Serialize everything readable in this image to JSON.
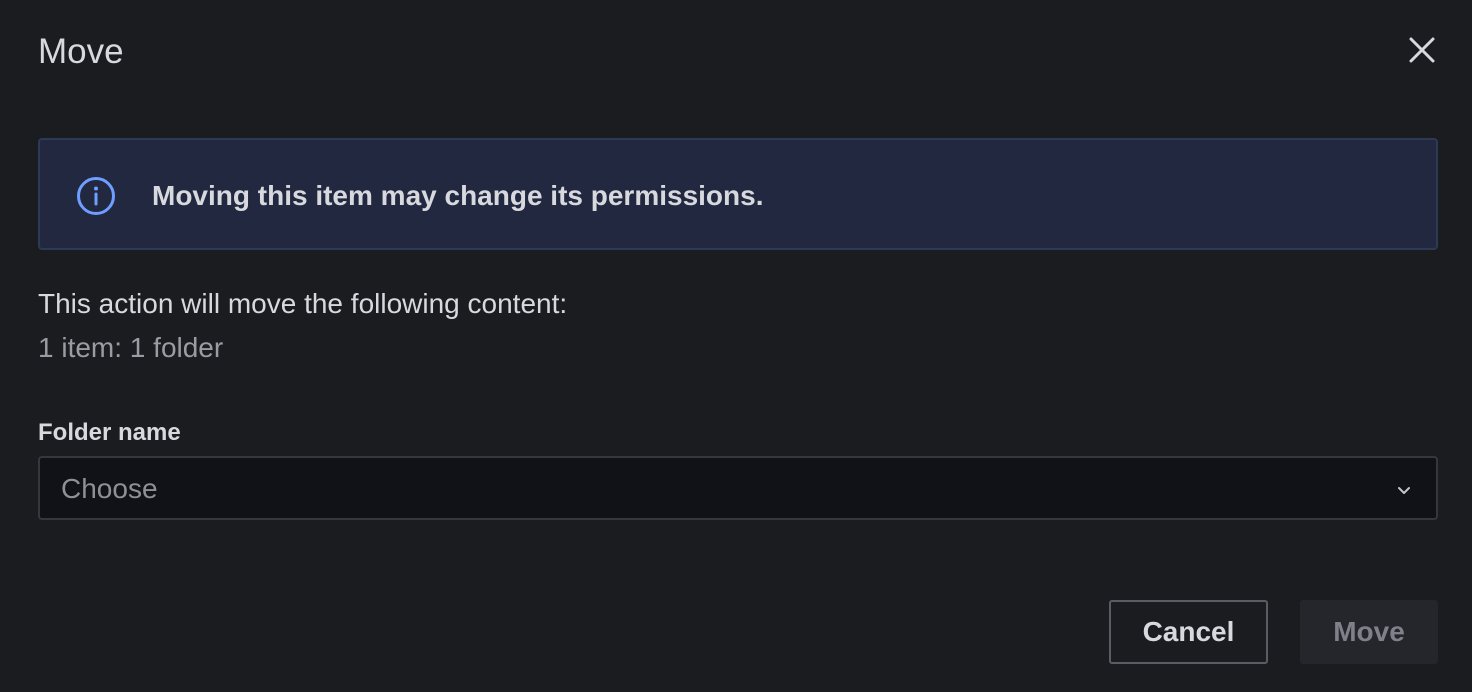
{
  "dialog": {
    "title": "Move",
    "close_icon": "close-icon"
  },
  "alert": {
    "icon": "info-circle-icon",
    "text": "Moving this item may change its permissions.",
    "accent_color": "#6e9fff"
  },
  "content": {
    "description": "This action will move the following content:",
    "summary": "1 item: 1 folder"
  },
  "folder_field": {
    "label": "Folder name",
    "placeholder": "Choose",
    "icon": "chevron-down-icon"
  },
  "actions": {
    "cancel_label": "Cancel",
    "move_label": "Move"
  }
}
